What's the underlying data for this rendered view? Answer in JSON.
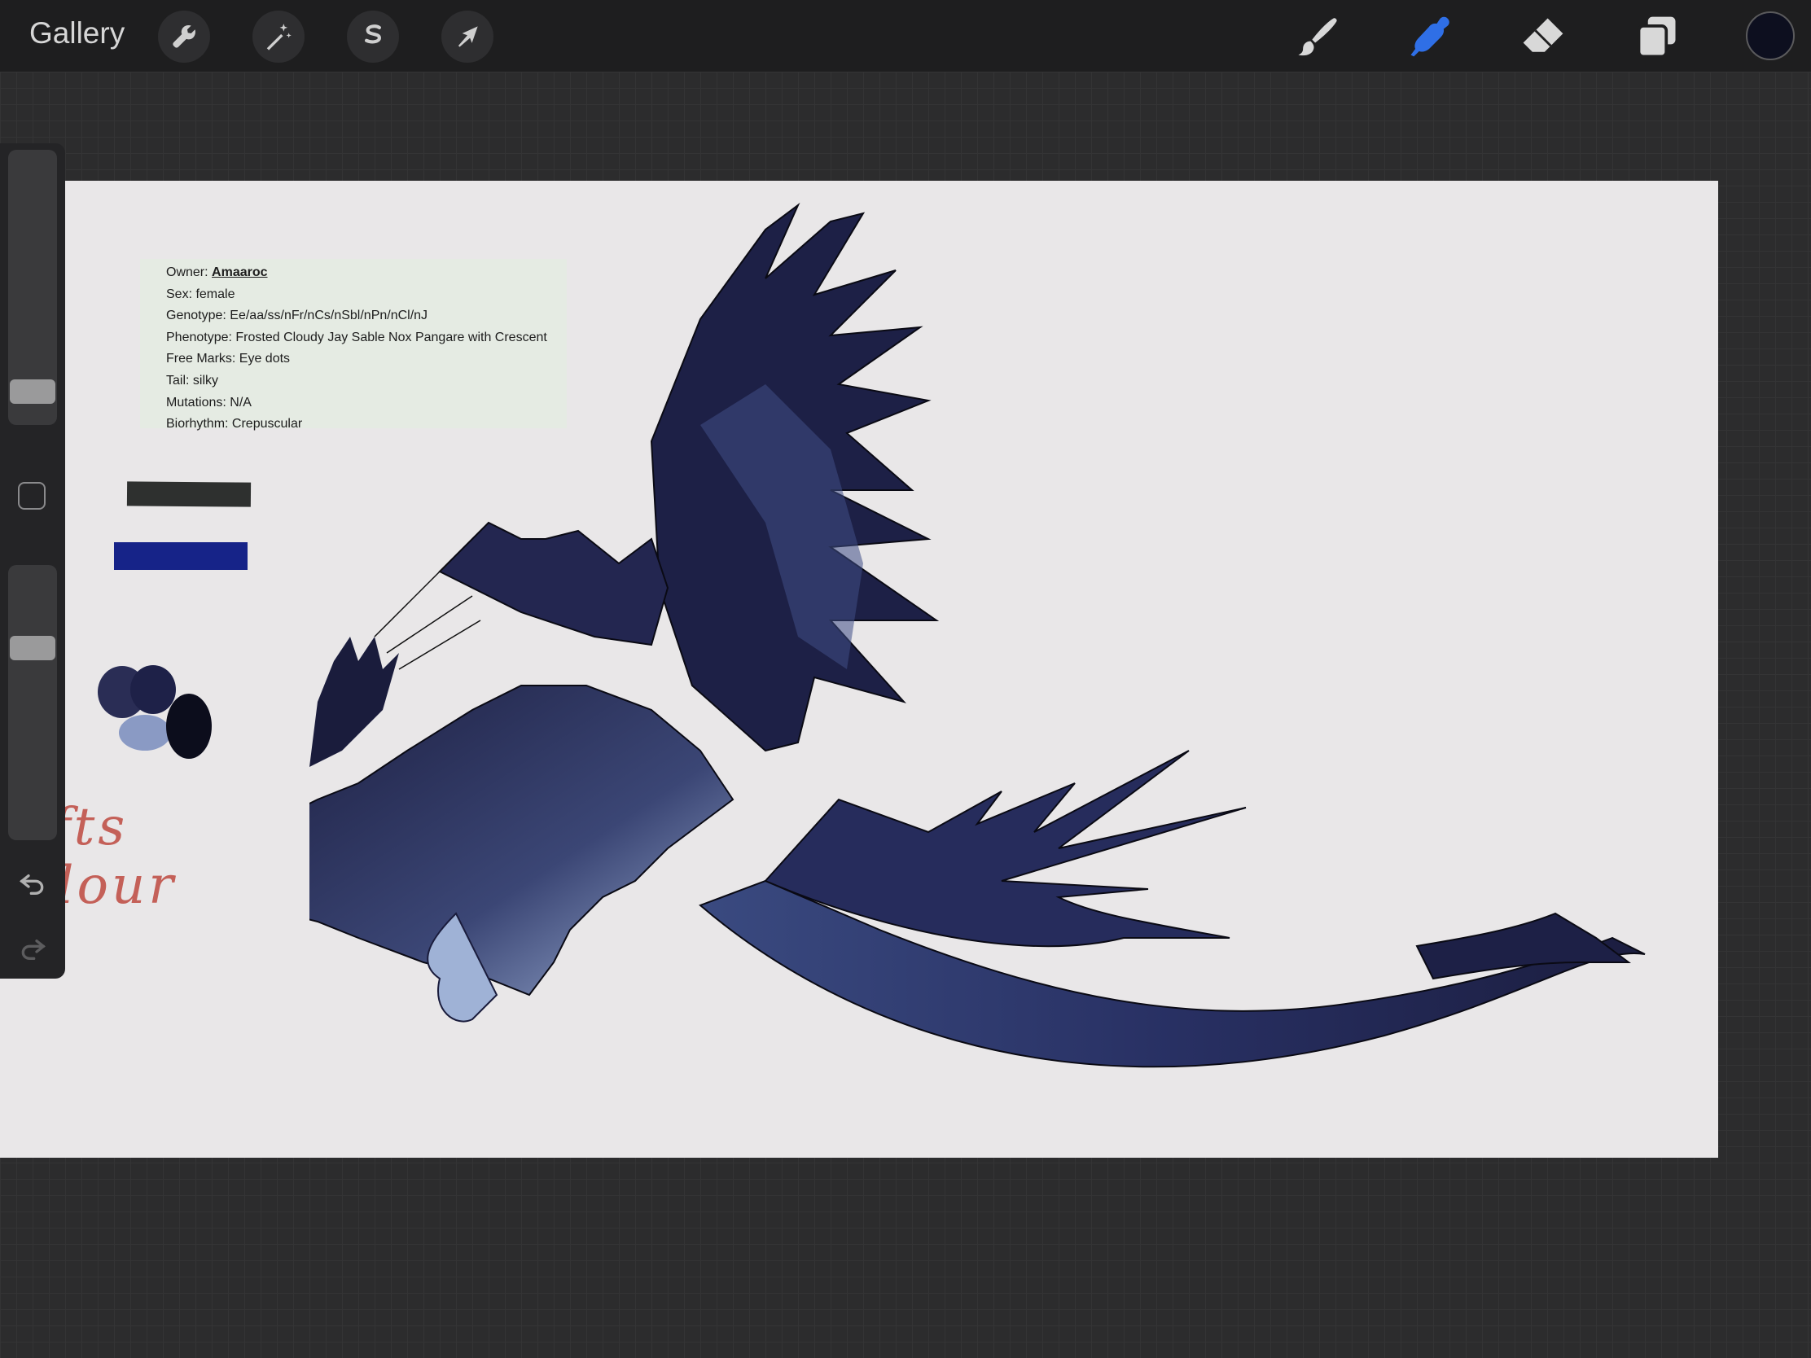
{
  "topbar": {
    "gallery_label": "Gallery",
    "left_tools": [
      "wrench-icon",
      "magic-wand-icon",
      "selection-s-icon",
      "transform-arrow-icon"
    ],
    "right_tools": [
      "brush-icon",
      "smudge-icon",
      "eraser-icon",
      "layers-icon"
    ],
    "active_tool": "smudge-icon",
    "accent_color": "#2f6fe6",
    "current_color": "#0d0f1f"
  },
  "canvas": {
    "info": {
      "owner_label": "Owner:",
      "owner_name": "Amaaroc",
      "sex": "Sex: female",
      "genotype": "Genotype: Ee/aa/ss/nFr/nCs/nSbl/nPn/nCl/nJ",
      "phenotype": "Phenotype: Frosted Cloudy Jay Sable Nox Pangare with Crescent",
      "free_marks": "Free Marks: Eye dots",
      "tail": "Tail: silky",
      "mutations": "Mutations: N/A",
      "biorhythm": "Biorhythm: Crepuscular"
    },
    "swatches": [
      "#2e302f",
      "#162388"
    ],
    "palette_blobs": [
      "#2a2d55",
      "#1e2148",
      "#8a9ac4",
      "#0c0d1c"
    ],
    "handwriting_line1": "tufts",
    "handwriting_line2": "velour",
    "handwriting_color": "#c46058"
  },
  "sidebar": {
    "brush_size_level": 0.08,
    "opacity_level": 0.72
  }
}
